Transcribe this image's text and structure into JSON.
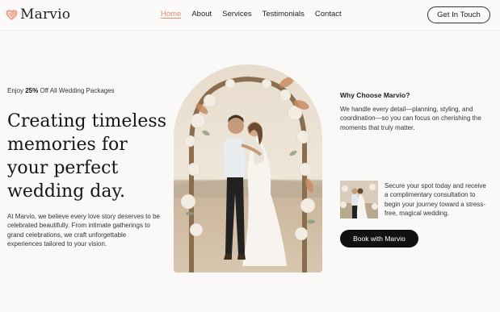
{
  "brand": {
    "name": "Marvio",
    "accent": "#e08a6e"
  },
  "nav": {
    "items": [
      "Home",
      "About",
      "Services",
      "Testimonials",
      "Contact"
    ],
    "active": "Home"
  },
  "header": {
    "cta_label": "Get In Touch"
  },
  "hero": {
    "promo_prefix": "Enjoy ",
    "promo_bold": "25%",
    "promo_suffix": " Off All Wedding Packages",
    "headline": "Creating timeless memories for your perfect wedding day.",
    "intro": "At Marvio, we believe every love story deserves to be celebrated beautifully. From intimate gatherings to grand celebrations, we craft unforgettable experiences tailored to your vision."
  },
  "why": {
    "title": "Why Choose Marvio?",
    "text": "We handle every detail—planning, styling, and coordination—so you can focus on cherishing the moments that truly matter."
  },
  "booking": {
    "text": "Secure your spot today and receive a complimentary consultation to begin your journey toward a stress-free, magical wedding.",
    "button_label": "Book with Marvio"
  }
}
